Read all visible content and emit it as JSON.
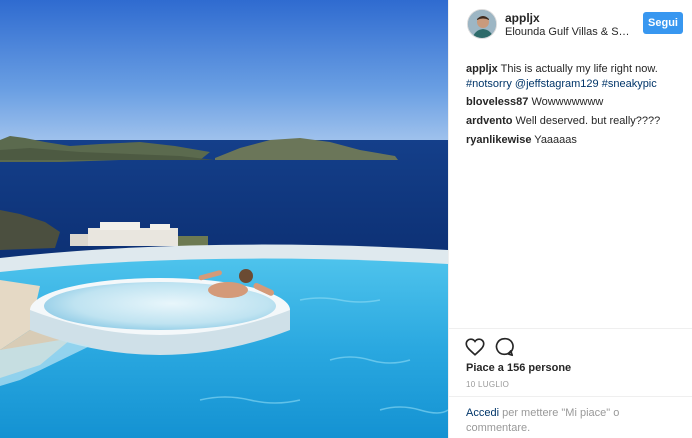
{
  "colors": {
    "follow_button": "#3897f0",
    "link": "#003569",
    "muted": "#999999",
    "text": "#262626"
  },
  "media": {
    "scene": "infinity-pool-overlooking-sea-photo"
  },
  "header": {
    "username": "appljx",
    "location": "Elounda Gulf Villas & Sui...",
    "follow_label": "Segui"
  },
  "caption": {
    "username": "appljx",
    "text": "This is actually my life right now.",
    "hashtag1": "#notsorry",
    "mention": "@jeffstagram129",
    "hashtag2": "#sneakypic"
  },
  "comments": [
    {
      "username": "bloveless87",
      "text": "Wowwwwwww"
    },
    {
      "username": "ardvento",
      "text": "Well deserved. but really????"
    },
    {
      "username": "ryanlikewise",
      "text": "Yaaaaas"
    }
  ],
  "actions": {
    "like_icon": "heart-icon",
    "comment_icon": "comment-bubble-icon",
    "likes_text": "Piace a 156 persone",
    "date": "10 LUGLIO"
  },
  "login": {
    "link": "Accedi",
    "text": "per mettere \"Mi piace\" o commentare."
  }
}
